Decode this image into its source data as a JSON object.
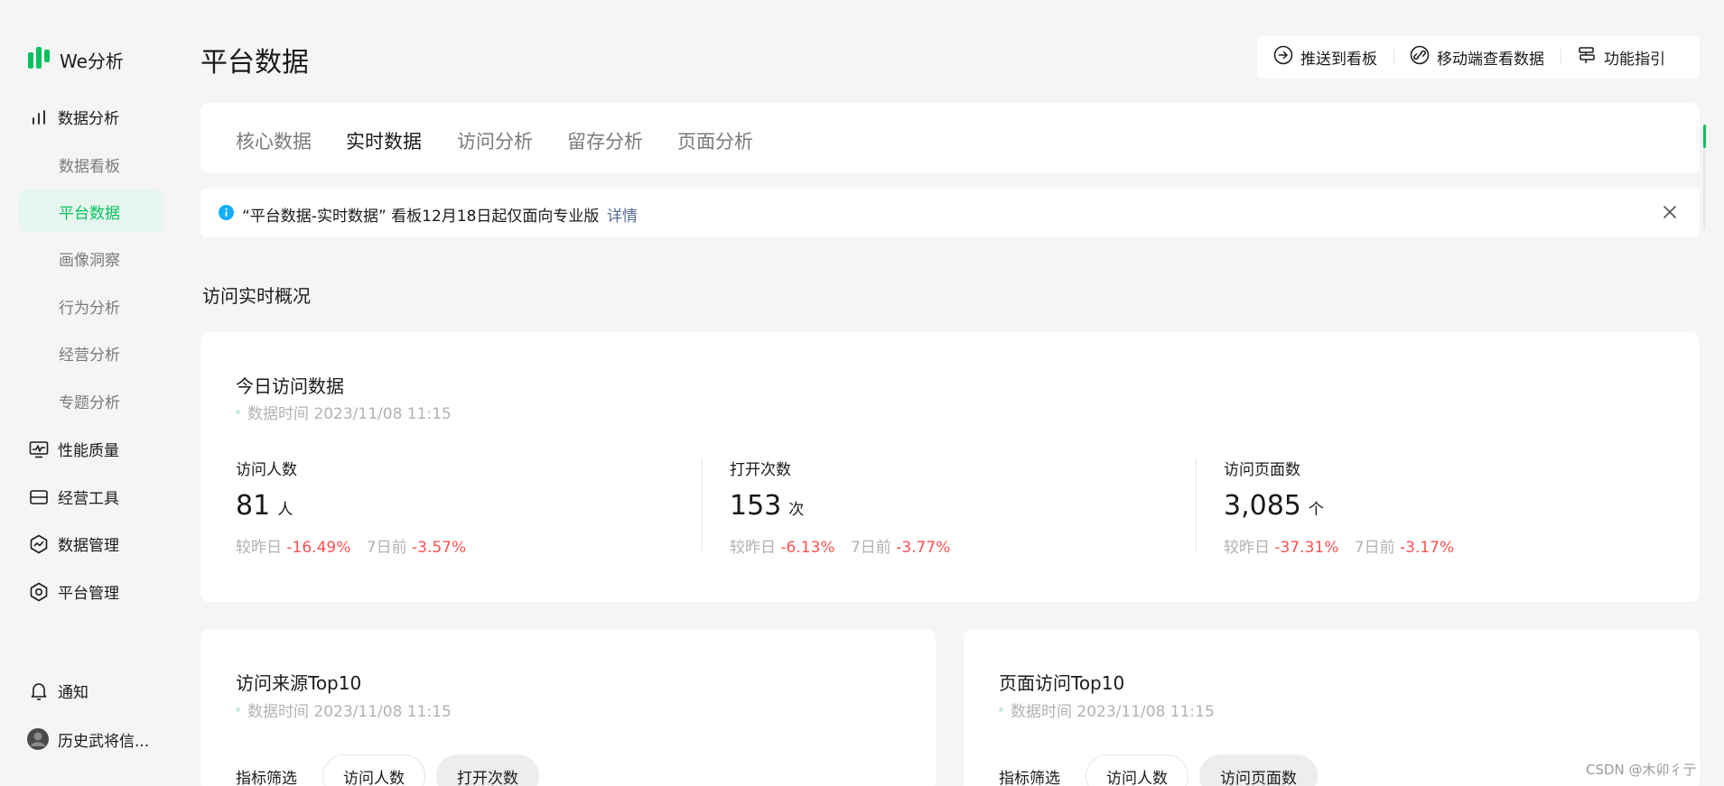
{
  "brand": {
    "name": "We分析"
  },
  "sidebar": {
    "groups": [
      {
        "label": "数据分析",
        "icon": "bar-chart-icon"
      },
      {
        "label": "性能质量",
        "icon": "monitor-icon"
      },
      {
        "label": "经营工具",
        "icon": "toolbox-icon"
      },
      {
        "label": "数据管理",
        "icon": "data-manage-icon"
      },
      {
        "label": "平台管理",
        "icon": "hexagon-settings-icon"
      }
    ],
    "sub_items": [
      {
        "label": "数据看板",
        "active": false
      },
      {
        "label": "平台数据",
        "active": true
      },
      {
        "label": "画像洞察",
        "active": false
      },
      {
        "label": "行为分析",
        "active": false
      },
      {
        "label": "经营分析",
        "active": false
      },
      {
        "label": "专题分析",
        "active": false
      }
    ],
    "notify_label": "通知",
    "user_name": "历史武将信..."
  },
  "header": {
    "title": "平台数据",
    "actions": [
      {
        "label": "推送到看板",
        "icon": "arrow-circle-icon"
      },
      {
        "label": "移动端查看数据",
        "icon": "link-icon"
      },
      {
        "label": "功能指引",
        "icon": "signpost-icon"
      }
    ]
  },
  "tabs": [
    {
      "label": "核心数据",
      "active": false
    },
    {
      "label": "实时数据",
      "active": true
    },
    {
      "label": "访问分析",
      "active": false
    },
    {
      "label": "留存分析",
      "active": false
    },
    {
      "label": "页面分析",
      "active": false
    }
  ],
  "notice": {
    "text": "“平台数据-实时数据” 看板12月18日起仅面向专业版",
    "link": "详情"
  },
  "section": {
    "title": "访问实时概况"
  },
  "today": {
    "title": "今日访问数据",
    "time": "数据时间 2023/11/08 11:15",
    "metrics": [
      {
        "label": "访问人数",
        "value": "81",
        "unit": "人",
        "day_label": "较昨日",
        "day": "-16.49%",
        "week_label": "7日前",
        "week": "-3.57%"
      },
      {
        "label": "打开次数",
        "value": "153",
        "unit": "次",
        "day_label": "较昨日",
        "day": "-6.13%",
        "week_label": "7日前",
        "week": "-3.77%"
      },
      {
        "label": "访问页面数",
        "value": "3,085",
        "unit": "个",
        "day_label": "较昨日",
        "day": "-37.31%",
        "week_label": "7日前",
        "week": "-3.17%"
      }
    ]
  },
  "source_top10": {
    "title": "访问来源Top10",
    "time": "数据时间 2023/11/08 11:15",
    "filter_label": "指标筛选",
    "filters": [
      {
        "label": "访问人数",
        "selected": false
      },
      {
        "label": "打开次数",
        "selected": true
      }
    ]
  },
  "page_top10": {
    "title": "页面访问Top10",
    "time": "数据时间 2023/11/08 11:15",
    "filter_label": "指标筛选",
    "filters": [
      {
        "label": "访问人数",
        "selected": false
      },
      {
        "label": "访问页面数",
        "selected": true
      }
    ]
  },
  "watermark": "CSDN @木卯彳亍",
  "colors": {
    "accent": "#07c160",
    "negative": "#fa5151",
    "link": "#576b95",
    "info": "#10aeff"
  }
}
